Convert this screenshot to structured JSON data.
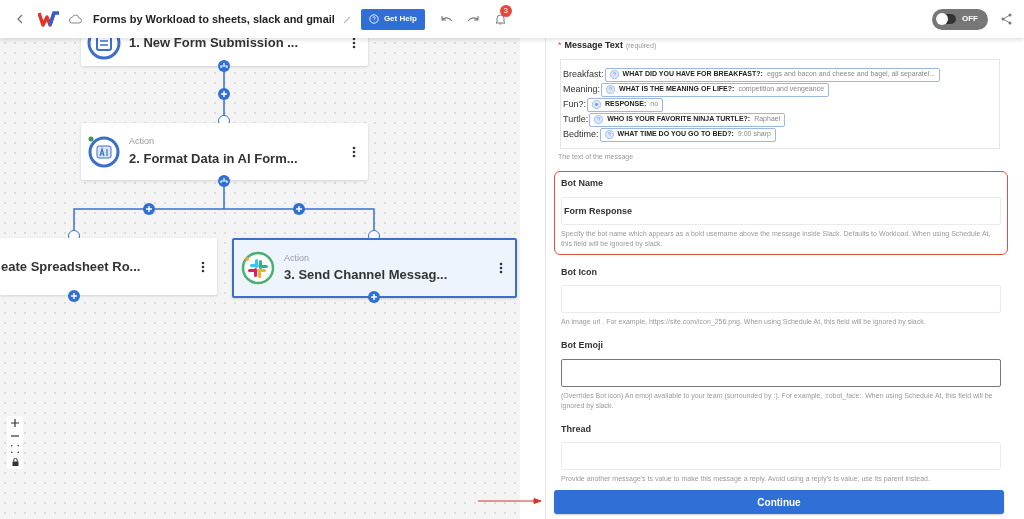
{
  "header": {
    "title": "Forms by Workload to sheets, slack and gmail",
    "help_button": "Get Help",
    "notification_count": "3",
    "toggle": {
      "label": "OFF",
      "on": false
    }
  },
  "canvas": {
    "nodes": [
      {
        "kind": "form",
        "title": "1. New Form Submission ...",
        "selected": false
      },
      {
        "kind": "ai",
        "label": "Action",
        "title": "2. Format Data in AI Form...",
        "selected": false
      },
      {
        "kind": "spreadsheet",
        "title": "eate Spreadsheet Ro...",
        "selected": false
      },
      {
        "kind": "chat",
        "label": "Action",
        "title": "3. Send Channel Messag...",
        "selected": true
      }
    ]
  },
  "form": {
    "message_text": {
      "required_mark": "*",
      "label": "Message Text",
      "required_note": "(required)",
      "help": "The text of the message",
      "rows": [
        {
          "prefix": "Breakfast:",
          "kind": "question",
          "field": "WHAT DID YOU HAVE FOR BREAKFAST?:",
          "value": "eggs and bacon and cheese and bagel, all separatel..."
        },
        {
          "prefix": "Meaning:",
          "kind": "question",
          "field": "WHAT IS THE MEANING OF LIFE?:",
          "value": "competition and vengeance"
        },
        {
          "prefix": "Fun?:",
          "kind": "choice",
          "field": "RESPONSE:",
          "value": "no"
        },
        {
          "prefix": "Turtle:",
          "kind": "question",
          "field": "WHO IS YOUR FAVORITE NINJA TURTLE?:",
          "value": "Raphael"
        },
        {
          "prefix": "Bedtime:",
          "kind": "question",
          "field": "WHAT TIME DO YOU GO TO BED?:",
          "value": "9:00 sharp"
        }
      ]
    },
    "fields": [
      {
        "label": "Bot Name",
        "value": "Form Response",
        "help": "Specify the bot name which appears as a bold username above the message inside Slack. Defaults to Workload. When using Schedule At, this field will be ignored by slack.",
        "highlighted": true,
        "focused": false
      },
      {
        "label": "Bot Icon",
        "help": "An image url . For example, https://site.com/icon_256.png. When using Schedule At, this field will be ignored by slack.",
        "highlighted": false,
        "focused": false
      },
      {
        "label": "Bot Emoji",
        "help": "(Overrides Bot icon) An emoji available to your team (surrounded by :). For example, :robot_face:. When using Schedule At, this field will be ignored by slack.",
        "highlighted": false,
        "focused": true
      },
      {
        "label": "Thread",
        "help": "Provide another message's ts value to make this message a reply. Avoid using a reply's ts value; use its parent instead.",
        "highlighted": false,
        "focused": false
      }
    ],
    "continue_button": "Continue"
  }
}
